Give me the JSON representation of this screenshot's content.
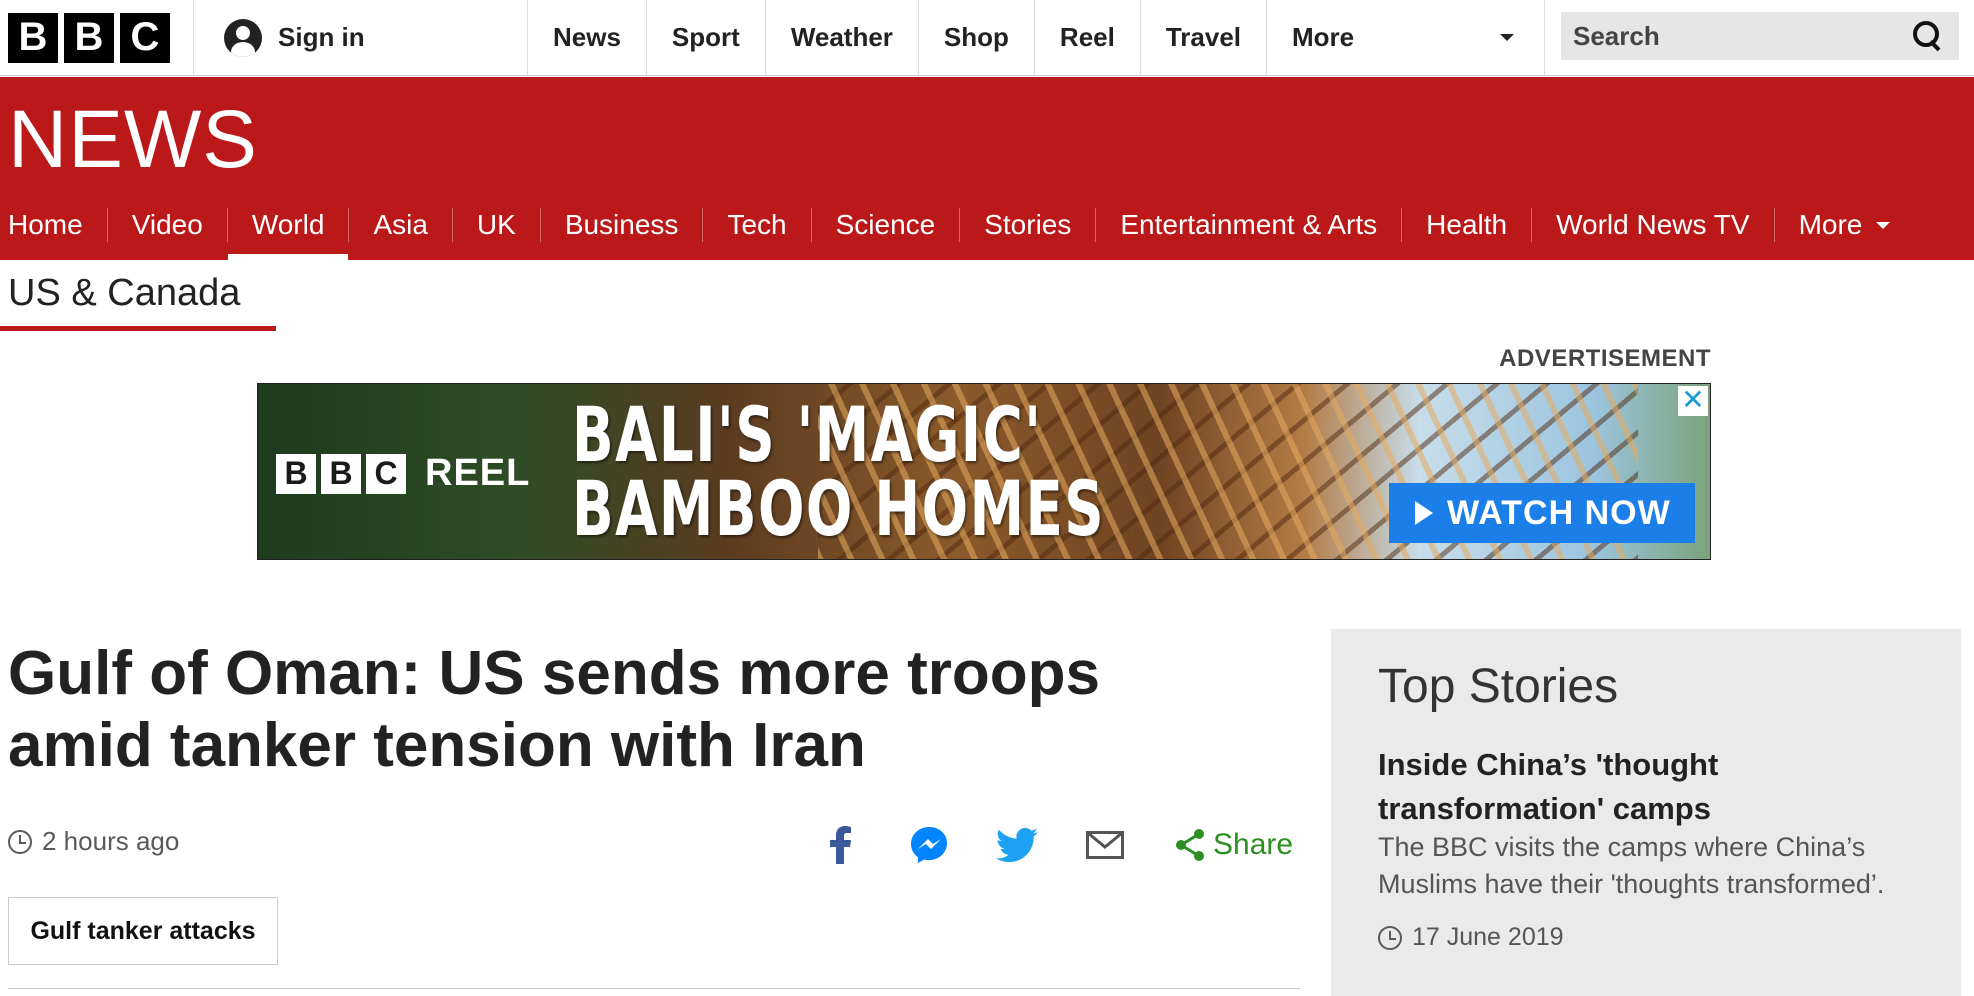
{
  "header": {
    "logo_letters": [
      "B",
      "B",
      "C"
    ],
    "signin_label": "Sign in",
    "nav": [
      {
        "label": "News"
      },
      {
        "label": "Sport"
      },
      {
        "label": "Weather"
      },
      {
        "label": "Shop"
      },
      {
        "label": "Reel"
      },
      {
        "label": "Travel"
      }
    ],
    "more_label": "More",
    "search_placeholder": "Search"
  },
  "banner": {
    "title": "NEWS",
    "color": "#bb1919"
  },
  "subnav": [
    {
      "label": "Home"
    },
    {
      "label": "Video"
    },
    {
      "label": "World",
      "active": true
    },
    {
      "label": "Asia"
    },
    {
      "label": "UK"
    },
    {
      "label": "Business"
    },
    {
      "label": "Tech"
    },
    {
      "label": "Science"
    },
    {
      "label": "Stories"
    },
    {
      "label": "Entertainment & Arts"
    },
    {
      "label": "Health"
    },
    {
      "label": "World News TV"
    },
    {
      "label": "More"
    }
  ],
  "section": {
    "title": "US & Canada"
  },
  "advertisement": {
    "label": "ADVERTISEMENT",
    "logo_letters": [
      "B",
      "B",
      "C"
    ],
    "brand": "REEL",
    "headline_line1": "BALI'S 'MAGIC'",
    "headline_line2": "BAMBOO HOMES",
    "cta": "WATCH NOW",
    "close_glyph": "✕",
    "cta_color": "#1c7ee8"
  },
  "article": {
    "headline": "Gulf of Oman: US sends more troops amid tanker tension with Iran",
    "timestamp": "2 hours ago",
    "share_label": "Share",
    "tag": "Gulf tanker attacks",
    "share_icons": [
      "facebook-icon",
      "messenger-icon",
      "twitter-icon",
      "email-icon",
      "share-icon"
    ]
  },
  "top_stories": {
    "heading": "Top Stories",
    "story": {
      "title": "Inside China’s 'thought transformation' camps",
      "summary": "The BBC visits the camps where China’s Muslims have their 'thoughts transformed’.",
      "date": "17 June 2019"
    }
  }
}
